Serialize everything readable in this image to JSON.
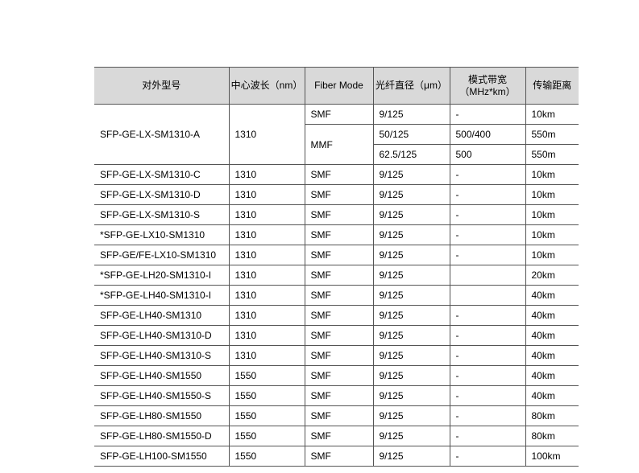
{
  "table": {
    "headers": [
      "对外型号",
      "中心波长（nm）",
      "Fiber Mode",
      "光纤直径（μm）",
      "模式带宽\n（MHz*km）",
      "传输距离"
    ],
    "first_group": {
      "model": "SFP-GE-LX-SM1310-A",
      "wavelength": "1310",
      "rows": [
        {
          "mode": "SMF",
          "diameter": "9/125",
          "bandwidth": "-",
          "distance": "10km"
        },
        {
          "mode": "MMF",
          "diameter": "50/125",
          "bandwidth": "500/400",
          "distance": "550m"
        },
        {
          "mode": "",
          "diameter": "62.5/125",
          "bandwidth": "500",
          "distance": "550m"
        }
      ]
    },
    "rows": [
      {
        "model": "SFP-GE-LX-SM1310-C",
        "wavelength": "1310",
        "mode": "SMF",
        "diameter": "9/125",
        "bandwidth": "-",
        "distance": "10km"
      },
      {
        "model": "SFP-GE-LX-SM1310-D",
        "wavelength": "1310",
        "mode": "SMF",
        "diameter": "9/125",
        "bandwidth": "-",
        "distance": "10km"
      },
      {
        "model": "SFP-GE-LX-SM1310-S",
        "wavelength": "1310",
        "mode": "SMF",
        "diameter": "9/125",
        "bandwidth": "-",
        "distance": "10km"
      },
      {
        "model": "*SFP-GE-LX10-SM1310",
        "wavelength": "1310",
        "mode": "SMF",
        "diameter": "9/125",
        "bandwidth": "-",
        "distance": "10km"
      },
      {
        "model": "SFP-GE/FE-LX10-SM1310",
        "wavelength": "1310",
        "mode": "SMF",
        "diameter": "9/125",
        "bandwidth": "-",
        "distance": "10km"
      },
      {
        "model": "*SFP-GE-LH20-SM1310-I",
        "wavelength": "1310",
        "mode": "SMF",
        "diameter": "9/125",
        "bandwidth": "",
        "distance": "20km"
      },
      {
        "model": "*SFP-GE-LH40-SM1310-I",
        "wavelength": "1310",
        "mode": "SMF",
        "diameter": "9/125",
        "bandwidth": "",
        "distance": "40km"
      },
      {
        "model": "SFP-GE-LH40-SM1310",
        "wavelength": "1310",
        "mode": "SMF",
        "diameter": "9/125",
        "bandwidth": "-",
        "distance": "40km"
      },
      {
        "model": "SFP-GE-LH40-SM1310-D",
        "wavelength": "1310",
        "mode": "SMF",
        "diameter": "9/125",
        "bandwidth": "-",
        "distance": "40km"
      },
      {
        "model": "SFP-GE-LH40-SM1310-S",
        "wavelength": "1310",
        "mode": "SMF",
        "diameter": "9/125",
        "bandwidth": "-",
        "distance": "40km"
      },
      {
        "model": "SFP-GE-LH40-SM1550",
        "wavelength": "1550",
        "mode": "SMF",
        "diameter": "9/125",
        "bandwidth": "-",
        "distance": "40km"
      },
      {
        "model": "SFP-GE-LH40-SM1550-S",
        "wavelength": "1550",
        "mode": "SMF",
        "diameter": "9/125",
        "bandwidth": "-",
        "distance": "40km"
      },
      {
        "model": "SFP-GE-LH80-SM1550",
        "wavelength": "1550",
        "mode": "SMF",
        "diameter": "9/125",
        "bandwidth": "-",
        "distance": "80km"
      },
      {
        "model": "SFP-GE-LH80-SM1550-D",
        "wavelength": "1550",
        "mode": "SMF",
        "diameter": "9/125",
        "bandwidth": "-",
        "distance": "80km"
      },
      {
        "model": "SFP-GE-LH100-SM1550",
        "wavelength": "1550",
        "mode": "SMF",
        "diameter": "9/125",
        "bandwidth": "-",
        "distance": "100km"
      }
    ]
  }
}
